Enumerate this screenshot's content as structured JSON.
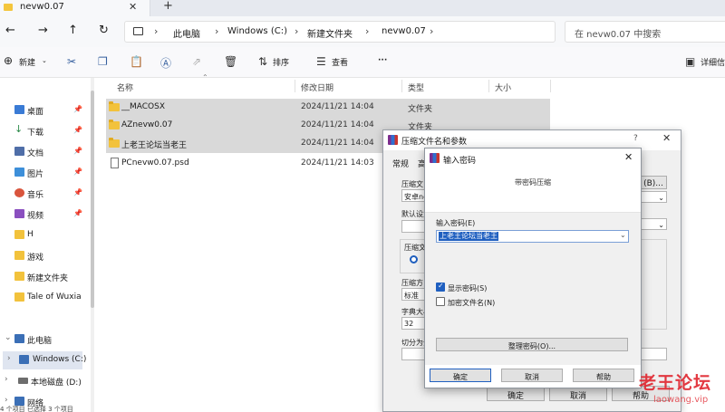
{
  "tab": {
    "title": "nevw0.07",
    "close": "✕",
    "new": "+"
  },
  "nav": {
    "back": "←",
    "forward": "→",
    "up": "↑",
    "refresh": "↻"
  },
  "breadcrumb": [
    "此电脑",
    "Windows (C:)",
    "新建文件夹",
    "nevw0.07"
  ],
  "breadcrumb_sep": "›",
  "search": {
    "placeholder": "在 nevw0.07 中搜索"
  },
  "toolbar": {
    "new_label": "新建",
    "sort_label": "排序",
    "view_label": "查看",
    "more": "···",
    "details_label": "详细信",
    "icons": [
      "cut-icon",
      "copy-icon",
      "paste-icon",
      "rename-icon",
      "share-icon",
      "delete-icon"
    ]
  },
  "sidebar": {
    "items": [
      {
        "label": "桌面",
        "pinned": true,
        "color": "#3a7bd5"
      },
      {
        "label": "下载",
        "pinned": true,
        "color": "#2c8a4a"
      },
      {
        "label": "文档",
        "pinned": true,
        "color": "#4f6ea8"
      },
      {
        "label": "图片",
        "pinned": true,
        "color": "#3d8fd9"
      },
      {
        "label": "音乐",
        "pinned": true,
        "color": "#d9553d"
      },
      {
        "label": "视频",
        "pinned": true,
        "color": "#8a4fbf"
      },
      {
        "label": "H",
        "pinned": false,
        "color": "#f2c23c"
      },
      {
        "label": "游戏",
        "pinned": false,
        "color": "#f2c23c"
      },
      {
        "label": "新建文件夹",
        "pinned": false,
        "color": "#f2c23c"
      },
      {
        "label": "Tale of Wuxia",
        "pinned": false,
        "color": "#f2c23c"
      }
    ],
    "tree": [
      {
        "label": "此电脑",
        "chevron": "⌄",
        "color": "#3b6fb6"
      },
      {
        "label": "Windows (C:)",
        "chevron": "›",
        "color": "#3b6fb6"
      },
      {
        "label": "本地磁盘 (D:)",
        "chevron": "›",
        "color": "#6d6d6d"
      },
      {
        "label": "网络",
        "chevron": "›",
        "color": "#3b6fb6"
      }
    ],
    "pin_glyph": "📌"
  },
  "columns": {
    "name": "名称",
    "modified": "修改日期",
    "type": "类型",
    "size": "大小"
  },
  "files": [
    {
      "name": "__MACOSX",
      "modified": "2024/11/21 14:04",
      "type": "文件夹",
      "kind": "folder",
      "selected": true
    },
    {
      "name": "AZnevw0.07",
      "modified": "2024/11/21 14:04",
      "type": "文件夹",
      "kind": "folder",
      "selected": true
    },
    {
      "name": "上老王论坛当老王",
      "modified": "2024/11/21 14:04",
      "type": "文件夹",
      "kind": "folder",
      "selected": true
    },
    {
      "name": "PCnevw0.07.psd",
      "modified": "2024/11/21 14:03",
      "type": "",
      "kind": "file",
      "selected": false
    }
  ],
  "rar_dialog": {
    "title": "压缩文件名和参数",
    "help": "?",
    "close": "✕",
    "tabs": [
      "常规",
      "高"
    ],
    "labels": [
      "压缩文",
      "默认设置",
      "压缩文",
      "压缩方",
      "字典大小",
      "切分为分"
    ],
    "fields": {
      "archive_name": "安卓ne",
      "method": "标准",
      "dictionary": "32"
    },
    "browse_button": "(B)...",
    "radio_glyph": "",
    "buttons": {
      "ok": "确定",
      "cancel": "取消",
      "help": "帮助"
    }
  },
  "password_dialog": {
    "title": "输入密码",
    "close": "✕",
    "subtitle": "带密码压缩",
    "password_label": "输入密码(E)",
    "password_value": "上老王论坛当老王",
    "dropdown": "⌄",
    "show_password": {
      "label": "显示密码(S)",
      "checked": true
    },
    "encrypt_names": {
      "label": "加密文件名(N)",
      "checked": false
    },
    "organize_button": "整理密码(O)...",
    "buttons": {
      "ok": "确定",
      "cancel": "取消",
      "help": "帮助"
    }
  },
  "status_bar": "4 个项目    已选择 3 个项目",
  "watermark": {
    "big": "老王论坛",
    "small": "laowang.vip",
    "color": "#e0242d"
  }
}
